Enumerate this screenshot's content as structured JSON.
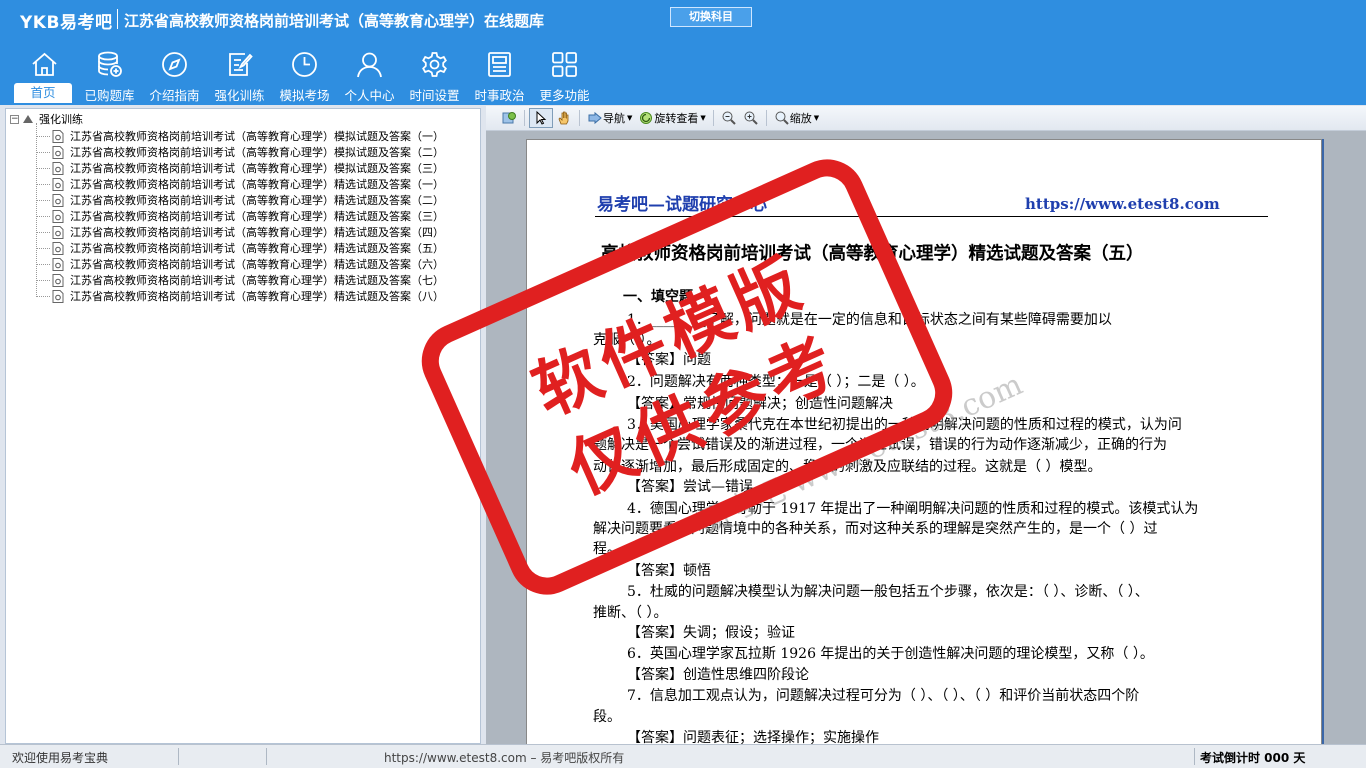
{
  "header": {
    "brand": "YKB易考吧",
    "title": "江苏省高校教师资格岗前培训考试（高等教育心理学）在线题库",
    "switch_button": "切换科目"
  },
  "nav": [
    {
      "label": "首页",
      "icon": "home-icon"
    },
    {
      "label": "已购题库",
      "icon": "database-icon"
    },
    {
      "label": "介绍指南",
      "icon": "compass-icon"
    },
    {
      "label": "强化训练",
      "icon": "edit-icon"
    },
    {
      "label": "模拟考场",
      "icon": "clock-icon"
    },
    {
      "label": "个人中心",
      "icon": "user-icon"
    },
    {
      "label": "时间设置",
      "icon": "gear-icon"
    },
    {
      "label": "时事政治",
      "icon": "news-icon"
    },
    {
      "label": "更多功能",
      "icon": "grid-icon"
    }
  ],
  "tree": {
    "root": "强化训练",
    "items": [
      "江苏省高校教师资格岗前培训考试（高等教育心理学）模拟试题及答案（一）",
      "江苏省高校教师资格岗前培训考试（高等教育心理学）模拟试题及答案（二）",
      "江苏省高校教师资格岗前培训考试（高等教育心理学）模拟试题及答案（三）",
      "江苏省高校教师资格岗前培训考试（高等教育心理学）精选试题及答案（一）",
      "江苏省高校教师资格岗前培训考试（高等教育心理学）精选试题及答案（二）",
      "江苏省高校教师资格岗前培训考试（高等教育心理学）精选试题及答案（三）",
      "江苏省高校教师资格岗前培训考试（高等教育心理学）精选试题及答案（四）",
      "江苏省高校教师资格岗前培训考试（高等教育心理学）精选试题及答案（五）",
      "江苏省高校教师资格岗前培训考试（高等教育心理学）精选试题及答案（六）",
      "江苏省高校教师资格岗前培训考试（高等教育心理学）精选试题及答案（七）",
      "江苏省高校教师资格岗前培训考试（高等教育心理学）精选试题及答案（八）"
    ]
  },
  "toolbar": {
    "nav_label": "导航",
    "rotate_label": "旋转查看",
    "zoom_label": "缩放"
  },
  "document": {
    "brand": "易考吧—试题研究中心",
    "url": "https://www.etest8.com",
    "heading": "高校教师资格岗前培训考试（高等教育心理学）精选试题及答案（五）",
    "lines": [
      "一、填空题",
      "1．________了解，问题就是在一定的信息和目标状态之间有某些障碍需要加以",
      "克服（    ）。",
      "【答案】问题",
      "2．问题解决有两种类型：一是（    ）；二是（    ）。",
      "【答案】常规性问题解决；创造性问题解决",
      "3．美国心理学家桑代克在本世纪初提出的一种阐明解决问题的性质和过程的模式，认为问",
      "题解决是一个尝试错误及的渐进过程，一个通过试误，错误的行为动作逐渐减少，正确的行为",
      "动作逐渐增加，最后形成固定的、稳定的刺激及应联结的过程。这就是（    ）模型。",
      "【答案】尝试—错误",
      "4．德国心理学家苛勒于 1917 年提出了一种阐明解决问题的性质和过程的模式。该模式认为",
      "解决问题要看出问题情境中的各种关系，而对这种关系的理解是突然产生的，是一个（    ）过",
      "程。",
      "【答案】顿悟",
      "5．杜威的问题解决模型认为解决问题一般包括五个步骤，依次是：（    ）、诊断、（    ）、",
      "推断、（    ）。",
      "【答案】失调；假设；验证",
      "6．英国心理学家瓦拉斯 1926 年提出的关于创造性解决问题的理论模型，又称（    ）。",
      "【答案】创造性思维四阶段论",
      "7．信息加工观点认为，问题解决过程可分为（    ）、（    ）、（    ）和评价当前状态四个阶",
      "段。",
      "【答案】问题表征；选择操作；实施操作"
    ]
  },
  "watermark": {
    "stamp_line1": "软件模版",
    "stamp_line2": "仅供参考",
    "diagonal": "易考吧  www.etest8.com"
  },
  "status": {
    "left": "欢迎使用易考宝典",
    "center": "https://www.etest8.com – 易考吧版权所有",
    "right": "考试倒计时 000 天"
  }
}
